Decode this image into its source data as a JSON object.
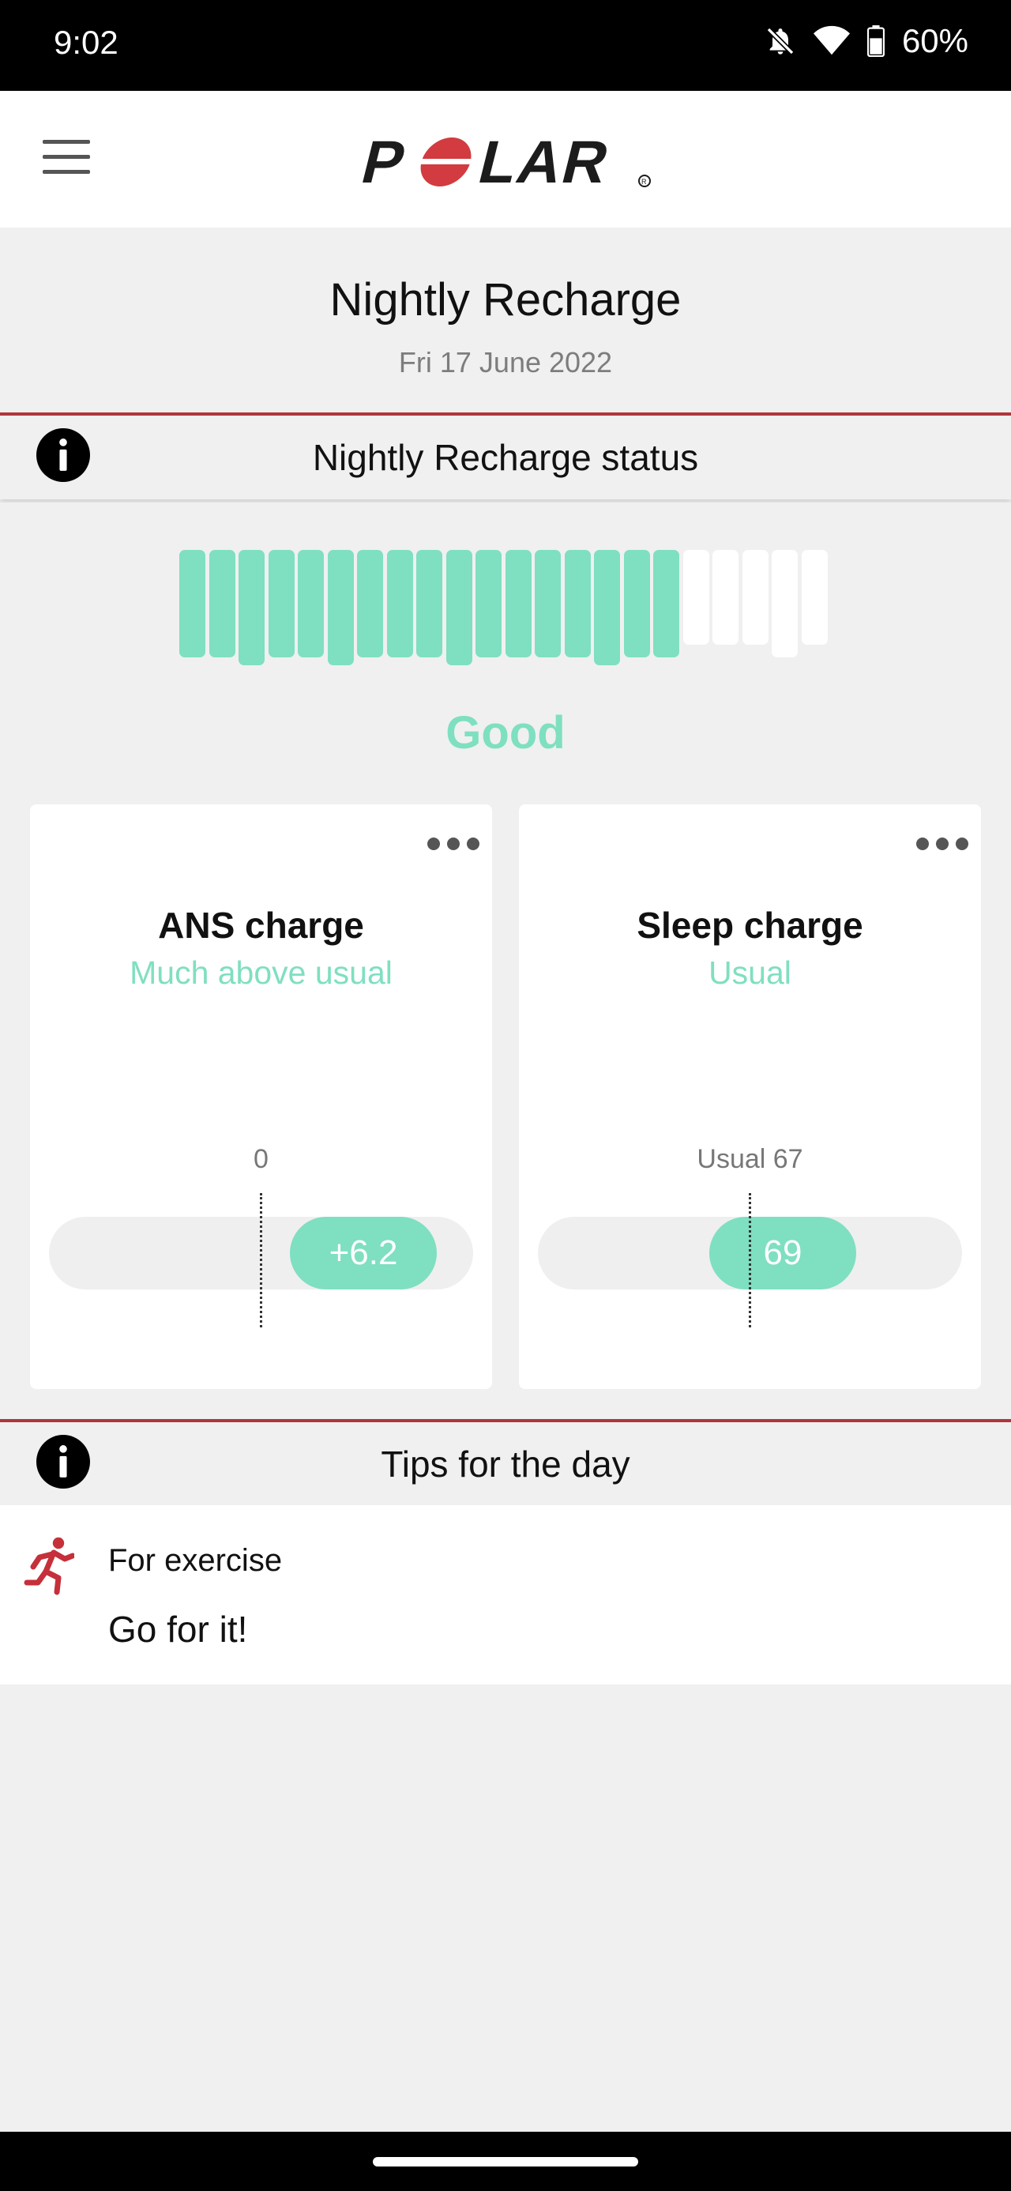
{
  "status_bar": {
    "time": "9:02",
    "battery": "60%",
    "icons": [
      "bell-off-icon",
      "wifi-icon",
      "battery-icon"
    ]
  },
  "app": {
    "logo_text": "POLAR",
    "menu_icon": "hamburger-icon"
  },
  "page": {
    "title": "Nightly Recharge",
    "date": "Fri 17 June 2022"
  },
  "recharge_status": {
    "section_title": "Nightly Recharge status",
    "status_label": "Good",
    "filled_bars": 17,
    "total_bars": 22,
    "colors": {
      "filled": "#7fdfc1",
      "empty": "#ffffff"
    }
  },
  "ans_card": {
    "title": "ANS charge",
    "subtitle": "Much above usual",
    "reference_label": "0",
    "value": "+6.2"
  },
  "sleep_card": {
    "title": "Sleep charge",
    "subtitle": "Usual",
    "reference_label": "Usual 67",
    "value": "69"
  },
  "tips": {
    "section_title": "Tips for the day",
    "category": "For exercise",
    "text": "Go for it!",
    "icon": "running-person-icon"
  },
  "theme": {
    "accent": "#b0353b",
    "mint": "#7fdfc1",
    "background": "#f0f0f0"
  }
}
